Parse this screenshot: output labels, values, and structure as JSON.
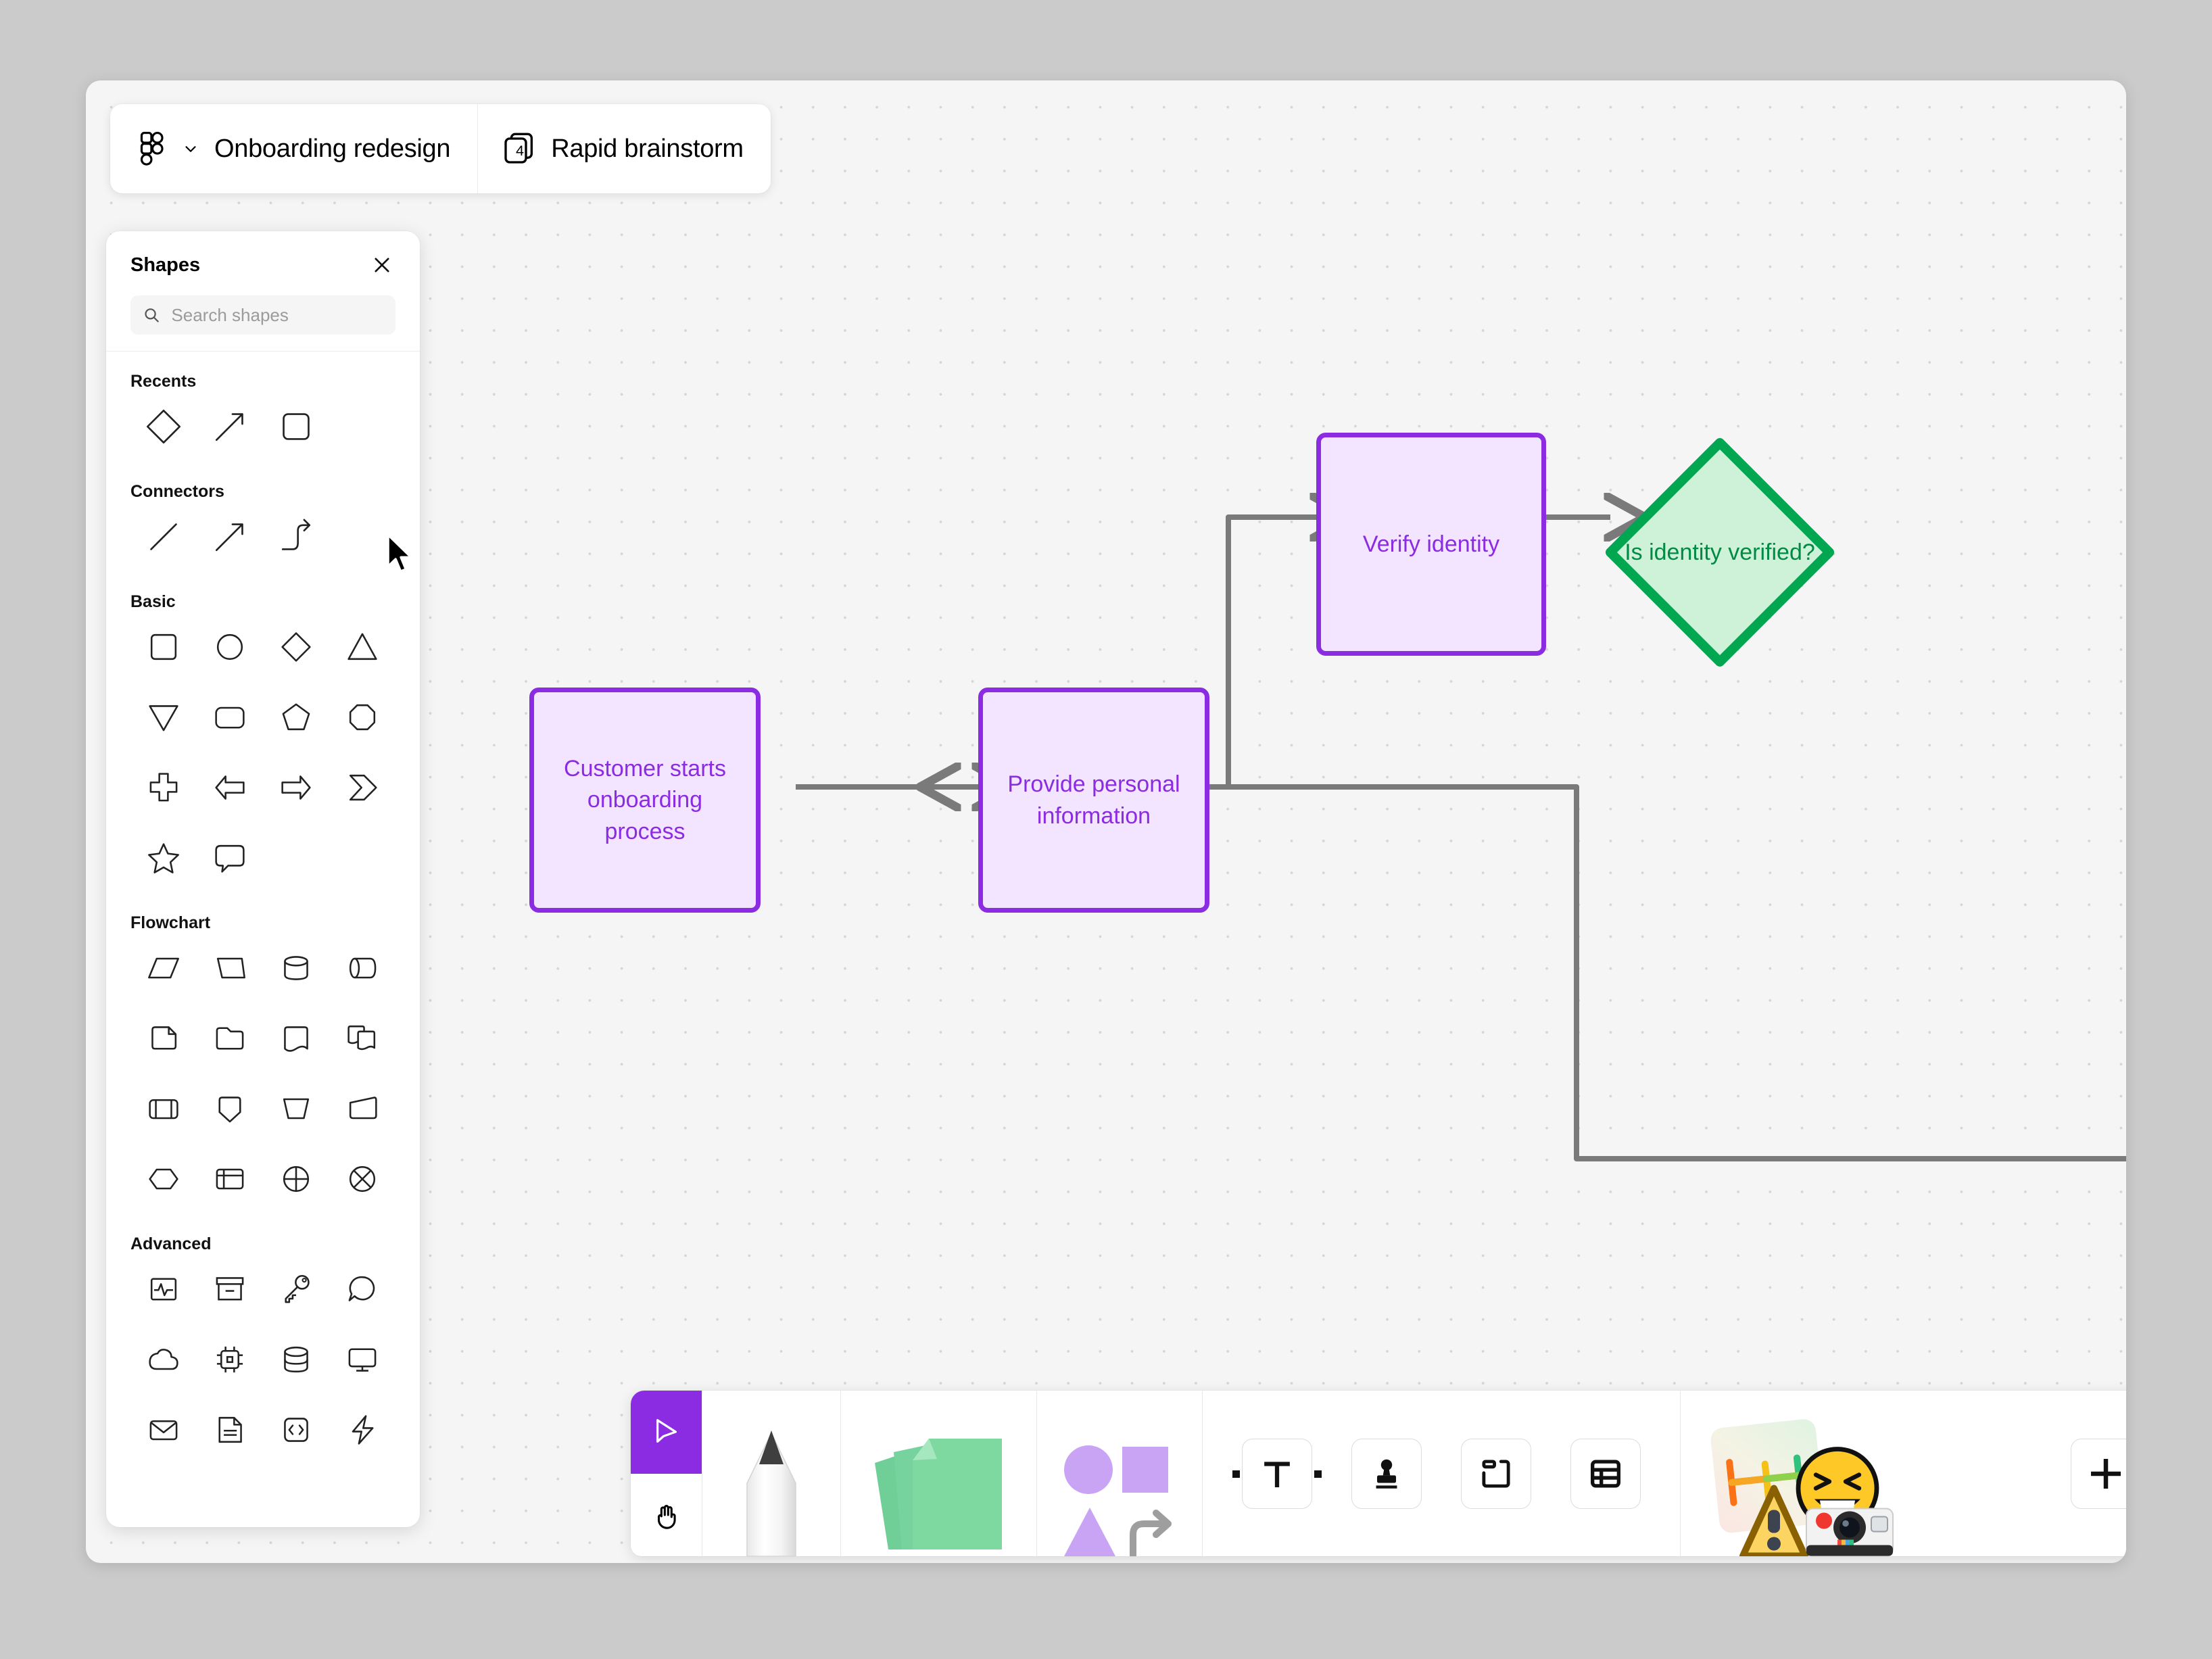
{
  "topbar": {
    "logo_icon": "figjam-logo-icon",
    "chevron_icon": "chevron-down-icon",
    "file_name": "Onboarding redesign",
    "session_icon": "stacked-cards-icon",
    "session_count": "4",
    "session_name": "Rapid brainstorm"
  },
  "panel": {
    "title": "Shapes",
    "close_icon": "close-icon",
    "search": {
      "icon": "search-icon",
      "placeholder": "Search shapes",
      "value": ""
    },
    "sections": [
      {
        "title": "Recents",
        "items": [
          {
            "name": "diamond-shape",
            "icon": "diamond"
          },
          {
            "name": "arrow-connector-shape",
            "icon": "arrow-line"
          },
          {
            "name": "rounded-square-shape",
            "icon": "rounded-square"
          }
        ]
      },
      {
        "title": "Connectors",
        "items": [
          {
            "name": "line-connector",
            "icon": "line"
          },
          {
            "name": "arrow-connector",
            "icon": "arrow-line"
          },
          {
            "name": "elbow-connector",
            "icon": "elbow-arrow"
          }
        ]
      },
      {
        "title": "Basic",
        "items": [
          {
            "name": "square-shape",
            "icon": "square"
          },
          {
            "name": "circle-shape",
            "icon": "circle"
          },
          {
            "name": "diamond-shape",
            "icon": "diamond"
          },
          {
            "name": "triangle-shape",
            "icon": "triangle"
          },
          {
            "name": "triangle-down-shape",
            "icon": "triangle-down"
          },
          {
            "name": "rounded-rectangle-shape",
            "icon": "rounded-rect"
          },
          {
            "name": "pentagon-shape",
            "icon": "pentagon"
          },
          {
            "name": "octagon-shape",
            "icon": "octagon"
          },
          {
            "name": "cross-shape",
            "icon": "cross"
          },
          {
            "name": "left-arrow-shape",
            "icon": "left-arrow"
          },
          {
            "name": "right-arrow-shape",
            "icon": "right-arrow"
          },
          {
            "name": "chevron-shape",
            "icon": "chevron"
          },
          {
            "name": "star-shape",
            "icon": "star"
          },
          {
            "name": "speech-bubble-shape",
            "icon": "speech-bubble"
          }
        ]
      },
      {
        "title": "Flowchart",
        "items": [
          {
            "name": "parallelogram-shape",
            "icon": "parallelogram"
          },
          {
            "name": "parallelogram-right-shape",
            "icon": "parallelogram-right"
          },
          {
            "name": "cylinder-shape",
            "icon": "cylinder"
          },
          {
            "name": "horizontal-cylinder-shape",
            "icon": "horizontal-cylinder"
          },
          {
            "name": "document-corner-shape",
            "icon": "page-fold"
          },
          {
            "name": "folder-shape",
            "icon": "folder"
          },
          {
            "name": "document-wave-shape",
            "icon": "document-wave"
          },
          {
            "name": "multi-document-shape",
            "icon": "multi-document"
          },
          {
            "name": "predefined-process-shape",
            "icon": "predefined-process"
          },
          {
            "name": "manual-input-down-shape",
            "icon": "shield-down"
          },
          {
            "name": "manual-operation-shape",
            "icon": "trapezoid"
          },
          {
            "name": "manual-input-shape",
            "icon": "manual-input"
          },
          {
            "name": "hexagon-shape",
            "icon": "hexagon"
          },
          {
            "name": "internal-storage-shape",
            "icon": "internal-storage"
          },
          {
            "name": "summing-junction-shape",
            "icon": "circle-cross"
          },
          {
            "name": "or-shape",
            "icon": "circle-x"
          }
        ]
      },
      {
        "title": "Advanced",
        "items": [
          {
            "name": "monitor-pulse-shape",
            "icon": "pulse-box"
          },
          {
            "name": "archive-box-shape",
            "icon": "archive-box"
          },
          {
            "name": "key-shape",
            "icon": "key"
          },
          {
            "name": "comment-bubble-shape",
            "icon": "comment-bubble"
          },
          {
            "name": "cloud-shape",
            "icon": "cloud"
          },
          {
            "name": "chip-shape",
            "icon": "chip"
          },
          {
            "name": "database-shape",
            "icon": "database"
          },
          {
            "name": "display-shape",
            "icon": "display"
          },
          {
            "name": "mail-shape",
            "icon": "mail"
          },
          {
            "name": "document-shape",
            "icon": "document"
          },
          {
            "name": "code-shape",
            "icon": "code"
          },
          {
            "name": "lightning-shape",
            "icon": "lightning"
          }
        ]
      }
    ]
  },
  "canvas": {
    "colors": {
      "node_border_purple": "#8b2be2",
      "node_fill_purple": "#f3e5ff",
      "node_text_purple": "#8b2be2",
      "node_border_green": "#00a650",
      "node_fill_green": "#cdf2d8",
      "node_text_green": "#008a45",
      "connector": "#7a7a7a",
      "canvas_bg": "#f5f5f5",
      "dot_grid": "#d6d6d6"
    },
    "nodes": [
      {
        "id": "start",
        "label": "Customer starts onboarding process",
        "shape": "rounded-rect",
        "color": "purple"
      },
      {
        "id": "provide",
        "label": "Provide personal information",
        "shape": "rounded-rect",
        "color": "purple"
      },
      {
        "id": "verify",
        "label": "Verify identity",
        "shape": "rounded-rect",
        "color": "purple"
      },
      {
        "id": "decision",
        "label": "Is identity verified?",
        "shape": "diamond",
        "color": "green"
      }
    ],
    "connections": [
      {
        "from": "start",
        "to": "provide",
        "style": "straight-arrow"
      },
      {
        "from": "provide",
        "to": "verify",
        "style": "elbow-arrow"
      },
      {
        "from": "verify",
        "to": "decision",
        "style": "straight-arrow"
      },
      {
        "from": "decision",
        "to": "provide",
        "style": "elbow-arrow-loopback"
      }
    ],
    "cursor_icon": "mouse-pointer-icon"
  },
  "toolbar": {
    "tools": [
      {
        "name": "select-tool",
        "icon": "cursor-arrow-icon",
        "active": true
      },
      {
        "name": "hand-tool",
        "icon": "hand-icon",
        "active": false
      },
      {
        "name": "pen-tool",
        "icon": "marker-pen-icon",
        "active": false
      },
      {
        "name": "sticky-note-tool",
        "icon": "sticky-notes-icon",
        "active": false
      },
      {
        "name": "shapes-tool",
        "icon": "shapes-icon",
        "active": false
      },
      {
        "name": "text-tool",
        "icon": "text-t-icon",
        "active": false
      },
      {
        "name": "stamp-tool",
        "icon": "stamp-icon",
        "active": false
      },
      {
        "name": "section-tool",
        "icon": "section-frame-icon",
        "active": false
      },
      {
        "name": "table-tool",
        "icon": "table-icon",
        "active": false
      },
      {
        "name": "widgets-tool",
        "icon": "widgets-icon",
        "active": false
      },
      {
        "name": "add-more-button",
        "icon": "plus-icon",
        "active": false
      }
    ]
  }
}
